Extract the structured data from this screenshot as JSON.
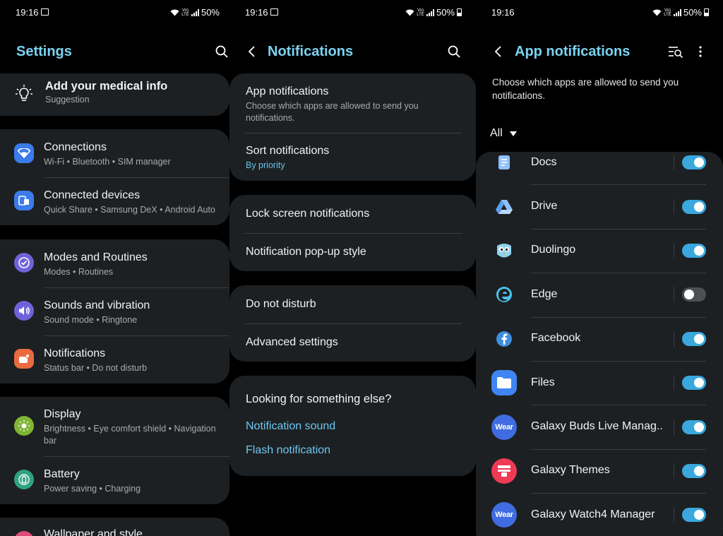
{
  "status": {
    "time": "19:16",
    "battery": "50%",
    "volte": "Vo) LTE"
  },
  "settings": {
    "title": "Settings",
    "medical": {
      "title": "Add your medical info",
      "subtitle": "Suggestion"
    },
    "items": [
      {
        "title": "Connections",
        "subtitle": "Wi-Fi  •  Bluetooth  •  SIM manager",
        "icon": "wifi-icon",
        "color": "#3b7bea"
      },
      {
        "title": "Connected devices",
        "subtitle": "Quick Share  •  Samsung DeX  •  Android Auto",
        "icon": "devices-icon",
        "color": "#3b7bea"
      },
      {
        "title": "Modes and Routines",
        "subtitle": "Modes  •  Routines",
        "icon": "check-circle-icon",
        "color": "#6f62d9"
      },
      {
        "title": "Sounds and vibration",
        "subtitle": "Sound mode  •  Ringtone",
        "icon": "speaker-icon",
        "color": "#6f62d9"
      },
      {
        "title": "Notifications",
        "subtitle": "Status bar  •  Do not disturb",
        "icon": "notification-icon",
        "color": "#ea6a3f"
      },
      {
        "title": "Display",
        "subtitle1": "Brightness  •  Eye comfort shield  •  Navigation",
        "subtitle2": "bar",
        "icon": "sun-icon",
        "color": "#7fb534"
      },
      {
        "title": "Battery",
        "subtitle": "Power saving  •  Charging",
        "icon": "battery-icon",
        "color": "#2fa27e"
      },
      {
        "title": "Wallpaper and style",
        "icon": "palette-icon",
        "color": "#e04a7a"
      }
    ]
  },
  "notifications": {
    "title": "Notifications",
    "app_notifications": {
      "title": "App notifications",
      "subtitle1": "Choose which apps are allowed to send you",
      "subtitle2": "notifications."
    },
    "sort": {
      "title": "Sort notifications",
      "subtitle": "By priority"
    },
    "lock_screen": "Lock screen notifications",
    "popup_style": "Notification pop-up style",
    "dnd": "Do not disturb",
    "advanced": "Advanced settings",
    "looking": {
      "title": "Looking for something else?",
      "link1": "Notification sound",
      "link2": "Flash notification"
    }
  },
  "app_notifications": {
    "title": "App notifications",
    "description1": "Choose which apps are allowed to send you",
    "description2": "notifications.",
    "filter": "All",
    "apps": [
      {
        "name": "Docs",
        "enabled": true,
        "icon": "docs-icon",
        "color": "#4a8af4"
      },
      {
        "name": "Drive",
        "enabled": true,
        "icon": "drive-icon",
        "color": "#ffffff"
      },
      {
        "name": "Duolingo",
        "enabled": true,
        "icon": "duolingo-icon",
        "color": "#58cc02"
      },
      {
        "name": "Edge",
        "enabled": false,
        "icon": "edge-icon",
        "color": "#1fa0e0"
      },
      {
        "name": "Facebook",
        "enabled": true,
        "icon": "facebook-icon",
        "color": "#1877f2"
      },
      {
        "name": "Files",
        "enabled": true,
        "icon": "files-icon",
        "color": "#3f86f4"
      },
      {
        "name": "Galaxy Buds Live Manag..",
        "enabled": true,
        "icon": "wear-icon",
        "color": "#3f6ce0",
        "label": "Wear"
      },
      {
        "name": "Galaxy Themes",
        "enabled": true,
        "icon": "themes-icon",
        "color": "#ee3a55"
      },
      {
        "name": "Galaxy Watch4 Manager",
        "enabled": true,
        "icon": "wear-icon",
        "color": "#3f6ce0",
        "label": "Wear"
      }
    ]
  }
}
